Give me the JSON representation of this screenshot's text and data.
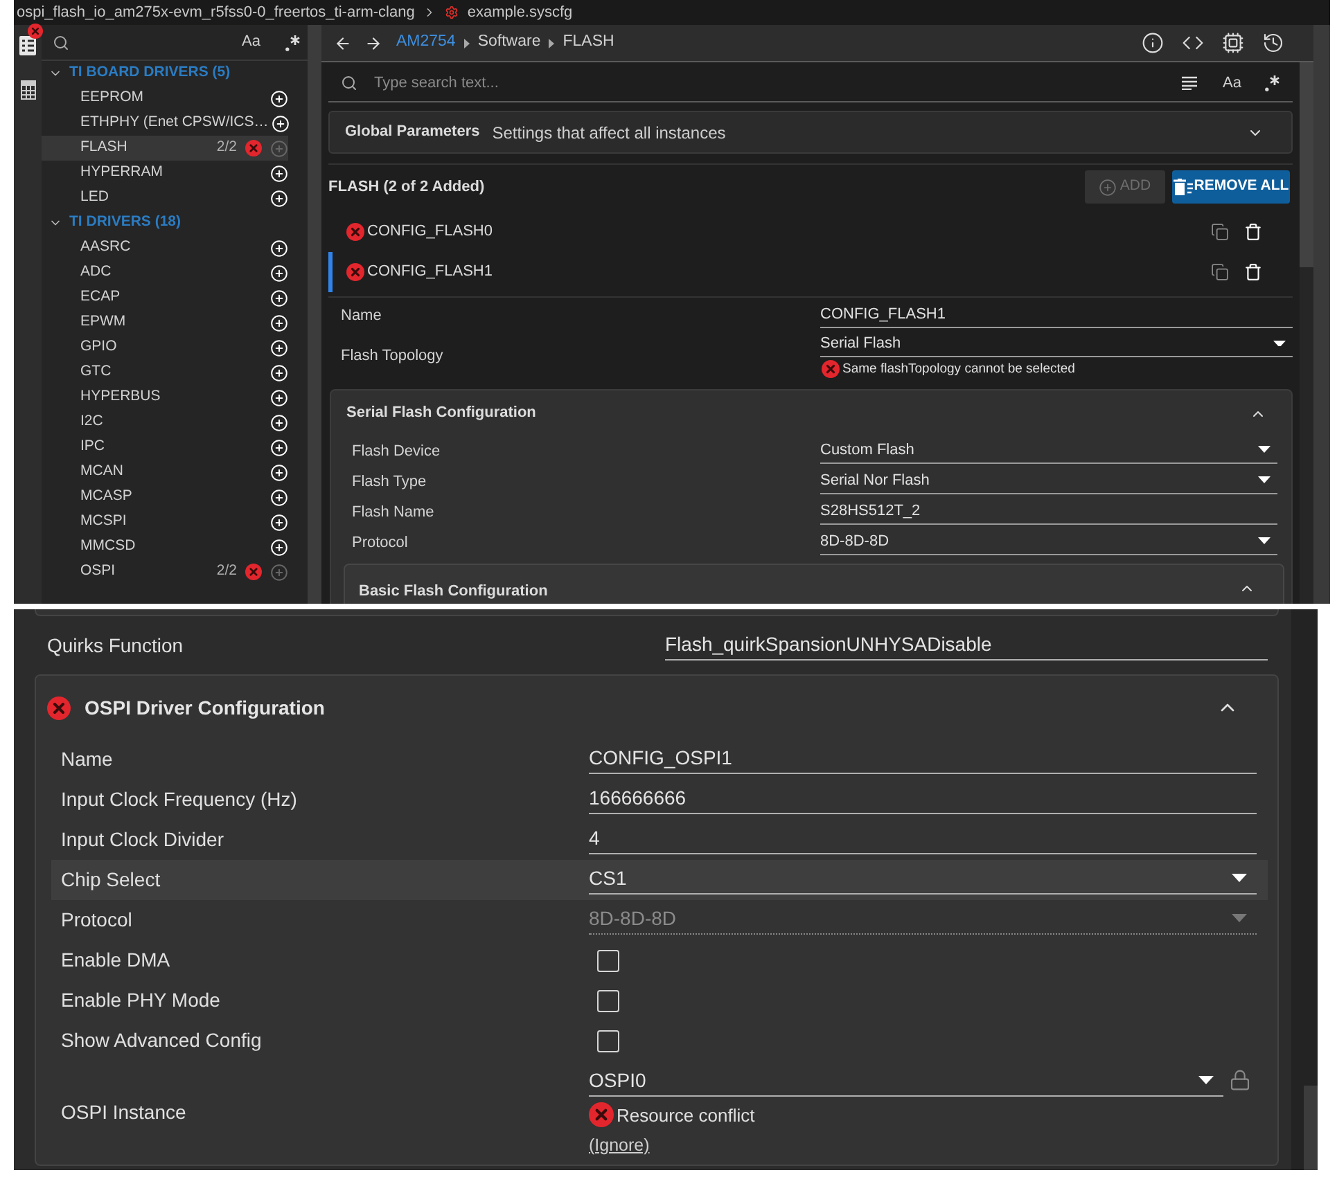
{
  "file_bar": {
    "project": "ospi_flash_io_am275x-evm_r5fss0-0_freertos_ti-arm-clang",
    "file": "example.syscfg"
  },
  "sidebar": {
    "search": {
      "case_toggle": "Aa"
    },
    "groups": [
      {
        "label": "TI BOARD DRIVERS (5)",
        "expanded": true,
        "items": [
          {
            "label": "EEPROM",
            "selected": false,
            "error": false,
            "add_disabled": false
          },
          {
            "label": "ETHPHY (Enet CPSW/ICS…",
            "selected": false,
            "error": false,
            "add_disabled": false
          },
          {
            "label": "FLASH",
            "count": "2/2",
            "selected": true,
            "error": true,
            "add_disabled": true
          },
          {
            "label": "HYPERRAM",
            "selected": false,
            "error": false,
            "add_disabled": false
          },
          {
            "label": "LED",
            "selected": false,
            "error": false,
            "add_disabled": false
          }
        ]
      },
      {
        "label": "TI DRIVERS (18)",
        "expanded": true,
        "items": [
          {
            "label": "AASRC",
            "selected": false,
            "error": false,
            "add_disabled": false
          },
          {
            "label": "ADC",
            "selected": false,
            "error": false,
            "add_disabled": false
          },
          {
            "label": "ECAP",
            "selected": false,
            "error": false,
            "add_disabled": false
          },
          {
            "label": "EPWM",
            "selected": false,
            "error": false,
            "add_disabled": false
          },
          {
            "label": "GPIO",
            "selected": false,
            "error": false,
            "add_disabled": false
          },
          {
            "label": "GTC",
            "selected": false,
            "error": false,
            "add_disabled": false
          },
          {
            "label": "HYPERBUS",
            "selected": false,
            "error": false,
            "add_disabled": false
          },
          {
            "label": "I2C",
            "selected": false,
            "error": false,
            "add_disabled": false
          },
          {
            "label": "IPC",
            "selected": false,
            "error": false,
            "add_disabled": false
          },
          {
            "label": "MCAN",
            "selected": false,
            "error": false,
            "add_disabled": false
          },
          {
            "label": "MCASP",
            "selected": false,
            "error": false,
            "add_disabled": false
          },
          {
            "label": "MCSPI",
            "selected": false,
            "error": false,
            "add_disabled": false
          },
          {
            "label": "MMCSD",
            "selected": false,
            "error": false,
            "add_disabled": false
          },
          {
            "label": "OSPI",
            "count": "2/2",
            "selected": false,
            "error": true,
            "add_disabled": true
          }
        ]
      }
    ]
  },
  "breadcrumb": [
    {
      "label": "AM2754",
      "kind": "link"
    },
    {
      "label": "Software",
      "kind": "text"
    },
    {
      "label": "FLASH",
      "kind": "text"
    }
  ],
  "search": {
    "placeholder": "Type search text...",
    "case_toggle": "Aa"
  },
  "global_parameters": {
    "title": "Global Parameters",
    "description": "Settings that affect all instances",
    "expanded": false
  },
  "module": {
    "title": "FLASH (2 of 2 Added)",
    "add_button": {
      "label": "ADD",
      "disabled": true
    },
    "remove_all_button": {
      "label": "REMOVE ALL"
    }
  },
  "instances": [
    {
      "name": "CONFIG_FLASH0",
      "error": true,
      "selected": false
    },
    {
      "name": "CONFIG_FLASH1",
      "error": true,
      "selected": true
    }
  ],
  "fields": [
    {
      "kind": "text",
      "label": "Name",
      "value": "CONFIG_FLASH1"
    },
    {
      "kind": "select",
      "label": "Flash Topology",
      "value": "Serial Flash",
      "error": "Same flashTopology cannot be selected"
    }
  ],
  "serial_flash_section": {
    "title": "Serial Flash Configuration",
    "expanded": true,
    "fields": [
      {
        "kind": "select",
        "label": "Flash Device",
        "value": "Custom Flash"
      },
      {
        "kind": "select",
        "label": "Flash Type",
        "value": "Serial Nor Flash"
      },
      {
        "kind": "text",
        "label": "Flash Name",
        "value": "S28HS512T_2"
      },
      {
        "kind": "select",
        "label": "Protocol",
        "value": "8D-8D-8D"
      }
    ],
    "subsections": [
      {
        "title": "Basic Flash Configuration",
        "expanded": true
      }
    ]
  },
  "detail": {
    "fields": [
      {
        "kind": "text",
        "label": "Quirks Function",
        "value": "Flash_quirkSpansionUNHYSADisable"
      }
    ],
    "ospi_section": {
      "title": "OSPI Driver Configuration",
      "error": true,
      "expanded": true,
      "fields": [
        {
          "kind": "text",
          "label": "Name",
          "value": "CONFIG_OSPI1",
          "disabled": false
        },
        {
          "kind": "text",
          "label": "Input Clock Frequency (Hz)",
          "value": "166666666",
          "disabled": false
        },
        {
          "kind": "text",
          "label": "Input Clock Divider",
          "value": "4",
          "disabled": false
        },
        {
          "kind": "select",
          "label": "Chip Select",
          "value": "CS1",
          "disabled": false,
          "hovered": true
        },
        {
          "kind": "select",
          "label": "Protocol",
          "value": "8D-8D-8D",
          "disabled": true
        },
        {
          "kind": "checkbox",
          "label": "Enable DMA",
          "checked": false,
          "disabled": false
        },
        {
          "kind": "checkbox",
          "label": "Enable PHY Mode",
          "checked": false,
          "disabled": false
        },
        {
          "kind": "checkbox",
          "label": "Show Advanced Config",
          "checked": false,
          "disabled": false
        },
        {
          "kind": "select",
          "label": "OSPI Instance",
          "value": "OSPI0",
          "locked": false,
          "error": "Resource conflict",
          "ignore_link": "(Ignore)",
          "disabled": false
        }
      ]
    }
  }
}
